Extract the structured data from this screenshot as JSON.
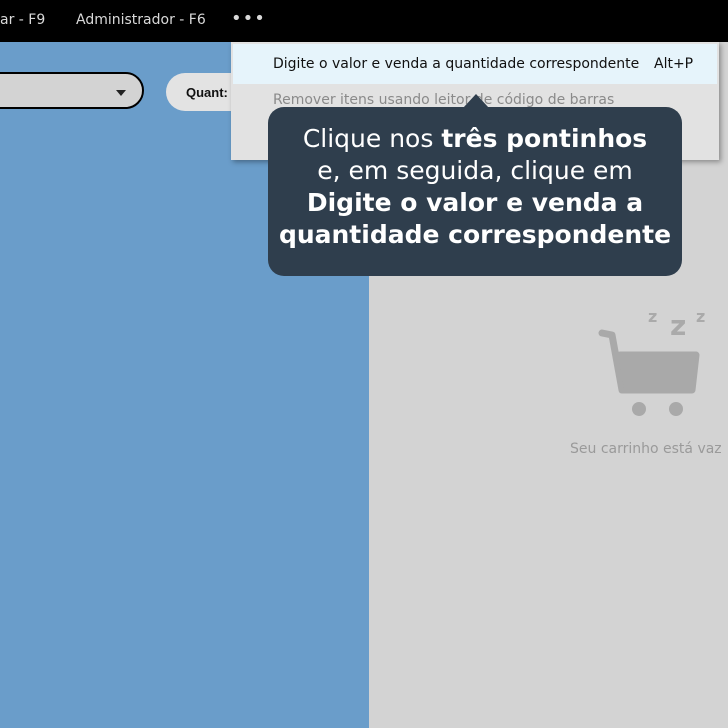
{
  "topbar": {
    "item1": "ar - F9",
    "item2": "Administrador - F6",
    "more": "•••"
  },
  "quantity": {
    "label": "Quant:"
  },
  "menu": {
    "option1_label": "Digite o valor e venda a quantidade correspondente",
    "option1_shortcut": "Alt+P",
    "option2_label": "Remover itens usando leitor de código de barras"
  },
  "tooltip": {
    "line1_pre": "Clique nos ",
    "line1_bold": "três pontinhos",
    "line2": "e, em seguida, clique em",
    "line3_bold": "Digite o valor e venda a",
    "line4_bold": "quantidade correspondente"
  },
  "cart": {
    "empty_text": "Seu carrinho está vaz",
    "sleep_z": "z"
  }
}
